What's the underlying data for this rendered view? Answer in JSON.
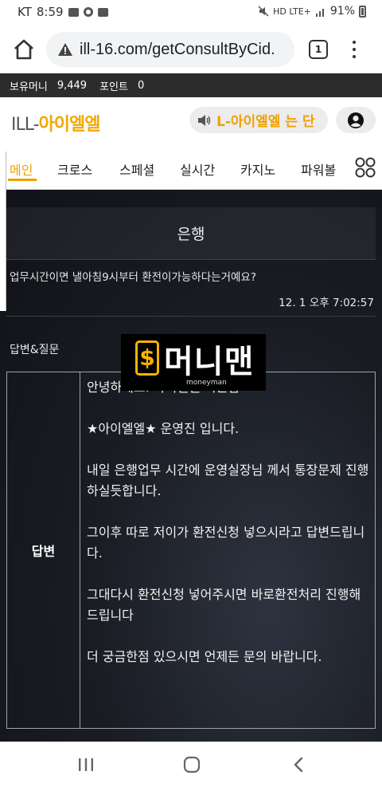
{
  "status_bar": {
    "carrier": "KT",
    "time": "8:59",
    "network": "HD LTE+",
    "battery": "91%",
    "icons": [
      "image-icon",
      "sync-icon",
      "app-icon",
      "mute-icon",
      "signal-icon",
      "battery-icon"
    ]
  },
  "browser": {
    "url": "ill-16.com/getConsultByCid.",
    "tab_count": "1",
    "icons": [
      "home-icon",
      "warning-icon",
      "tabs-icon",
      "more-vert-icon"
    ]
  },
  "account": {
    "money_label": "보유머니",
    "money_value": "9,449",
    "point_label": "포인트",
    "point_value": "0"
  },
  "header": {
    "logo_prefix": "ILL-",
    "logo_main": "아이엘엘",
    "notice": "L-아이엘엘 는 단",
    "icons": [
      "speaker-icon",
      "user-icon"
    ]
  },
  "nav": {
    "items": [
      "메인",
      "크로스",
      "스페셜",
      "실시간",
      "카지노",
      "파워볼"
    ],
    "active_index": 0,
    "more_icon": "grid-icon"
  },
  "consult": {
    "category": "은행",
    "question": "업무시간이면 낼아침9시부터 환전이가능하다는거예요?",
    "time": "12. 1 오후 7:02:57",
    "section_label": "답변&질문",
    "answer_label": "답변",
    "answer_paragraphs": [
      "안녕하세요. 아이엘엘 회원님",
      "★아이엘엘★ 운영진 입니다.",
      "내일 은행업무 시간에 운영실장님 께서 통장문제 진행하실듯합니다.",
      "그이후 따로 저이가 환전신청 넣으시라고 답변드립니다.",
      "그대다시 환전신청 넣어주시면 바로환전처리 진행해드립니다",
      "더 궁금한점 있으시면 언제든 문의 바랍니다."
    ]
  },
  "watermark": {
    "symbol": "$",
    "text": "머니맨",
    "subtext": "moneyman"
  },
  "system_nav": {
    "icons": [
      "recent-apps-icon",
      "home-circle-icon",
      "back-icon"
    ]
  },
  "colors": {
    "accent": "#f0a000",
    "dark_bg": "#14161c",
    "money_bar": "#2c2c2c"
  }
}
